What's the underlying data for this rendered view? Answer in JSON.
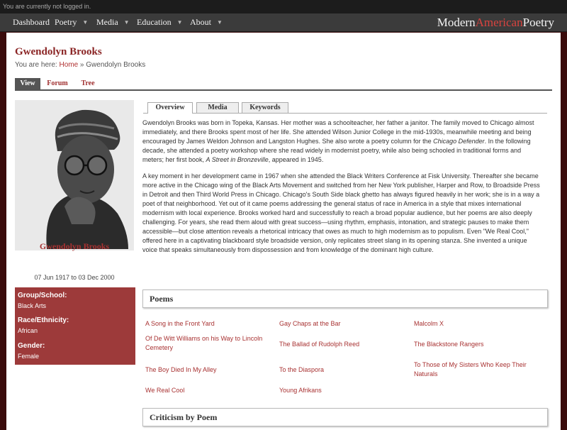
{
  "topbar": {
    "status": "You are currently not logged in."
  },
  "nav": {
    "items": [
      "Dashboard",
      "Poetry",
      "Media",
      "Education",
      "About"
    ],
    "brand": {
      "part1": "Modern",
      "part2": "American",
      "part3": "Poetry"
    }
  },
  "page": {
    "title": "Gwendolyn Brooks",
    "breadcrumb": {
      "prefix": "You are here: ",
      "home": "Home",
      "separator": " » ",
      "current": "Gwendolyn Brooks"
    }
  },
  "view_tabs": [
    "View",
    "Forum",
    "Tree"
  ],
  "person": {
    "name": "Gwendolyn Brooks",
    "dates": "07 Jun 1917 to 03 Dec 2000",
    "info": [
      {
        "label": "Group/School:",
        "value": "Black Arts"
      },
      {
        "label": "Race/Ethnicity:",
        "value": "African"
      },
      {
        "label": "Gender:",
        "value": "Female"
      }
    ]
  },
  "content_tabs": [
    "Overview",
    "Media",
    "Keywords"
  ],
  "bio": {
    "p1_before": "Gwendolyn Brooks was born in Topeka, Kansas. Her mother was a schoolteacher, her father a janitor. The family moved to Chicago almost immediately, and there Brooks spent most of her life. She attended Wilson Junior College in the mid-1930s, meanwhile meeting and being encouraged by James Weldon Johnson and Langston Hughes. She also wrote a poetry column for the ",
    "p1_italic1": "Chicago Defender",
    "p1_middle": ". In the following decade, she attended a poetry workshop where she read widely in modernist poetry, while also being schooled in traditional forms and meters; her first book, ",
    "p1_italic2": "A Street in Bronzeville",
    "p1_after": ", appeared in 1945.",
    "p2": "A key moment in her development came in 1967 when she attended the Black Writers Conference at Fisk University. Thereafter she became more active in the Chicago wing of the Black Arts Movement and switched from her New York publisher, Harper and Row, to Broadside Press in Detroit and then Third World Press in Chicago. Chicago's South Side black ghetto has always figured heavily in her work; she is in a way a poet of that neighborhood. Yet out of it came poems addressing the general status of race in America in a style that mixes international modernism with local experience. Brooks worked hard and successfully to reach a broad popular audience, but her poems are also deeply challenging. For years, she read them aloud with great success—using rhythm, emphasis, intonation, and strategic pauses to make them accessible—but close attention reveals a rhetorical intricacy that owes as much to high modernism as to populism. Even \"We Real Cool,\" offered here in a captivating blackboard style broadside version, only replicates street slang in its opening stanza. She invented a unique voice that speaks simultaneously from dispossession and from knowledge of the dominant high culture."
  },
  "poems": {
    "heading": "Poems",
    "items": [
      "A Song in the Front Yard",
      "Gay Chaps at the Bar",
      "Malcolm X",
      "Of De Witt Williams on his Way to Lincoln Cemetery",
      "The Ballad of Rudolph Reed",
      "The Blackstone Rangers",
      "The Boy Died In My Alley",
      "To the Diaspora",
      "To Those of My Sisters Who Keep Their Naturals",
      "We Real Cool",
      "Young Afrikans"
    ]
  },
  "criticism": {
    "heading": "Criticism by Poem"
  },
  "colors": {
    "accent": "#a83232",
    "infobox": "#9d3a3a",
    "background": "#3a0c0c"
  }
}
